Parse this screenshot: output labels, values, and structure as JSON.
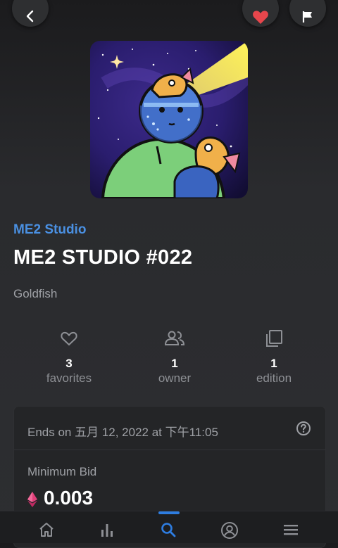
{
  "header": {
    "back_icon": "chevron-left-icon",
    "favorite_icon": "heart-icon",
    "report_icon": "flag-icon",
    "favorite_color": "#e8464c"
  },
  "nft": {
    "collection": "ME2 Studio",
    "title": "ME2 STUDIO #022",
    "description": "Goldfish",
    "image_alt": "Cosmic astronaut with goldfish artwork"
  },
  "stats": {
    "favorites": {
      "value": "3",
      "label": "favorites",
      "icon": "heart-outline-icon"
    },
    "owners": {
      "value": "1",
      "label": "owner",
      "icon": "people-icon"
    },
    "editions": {
      "value": "1",
      "label": "edition",
      "icon": "copy-icon"
    }
  },
  "auction": {
    "ends_text": "Ends on 五月 12, 2022 at 下午11:05",
    "help_icon": "question-circle-icon",
    "min_bid_label": "Minimum Bid",
    "min_bid_value": "0.003",
    "currency_icon": "ethereum-icon"
  },
  "bottom_nav": {
    "items": [
      "home-icon",
      "stats-icon",
      "search-icon",
      "account-icon",
      "menu-icon"
    ],
    "active": "search-icon",
    "accent": "#2e7de1"
  }
}
